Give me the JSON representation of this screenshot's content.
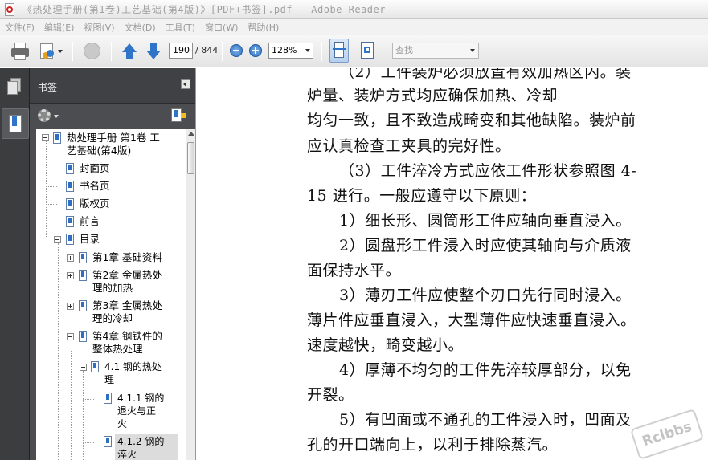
{
  "window": {
    "title": "《热处理手册(第1卷)工艺基础(第4版)》[PDF+书签].pdf - Adobe Reader"
  },
  "menu": [
    {
      "label": "文件(F)"
    },
    {
      "label": "编辑(E)"
    },
    {
      "label": "视图(V)"
    },
    {
      "label": "文档(D)"
    },
    {
      "label": "工具(T)"
    },
    {
      "label": "窗口(W)"
    },
    {
      "label": "帮助(H)"
    }
  ],
  "toolbar": {
    "page_current": "190",
    "page_total": "/ 844",
    "zoom": "128%",
    "find_placeholder": "查找"
  },
  "icons": {
    "print": "printer-icon",
    "review": "review-icon",
    "globe": "globe-icon",
    "prev": "arrow-up-icon",
    "next": "arrow-down-icon",
    "zoom_out": "zoom-out-icon",
    "zoom_in": "zoom-in-icon",
    "fit_width": "fit-width-icon",
    "fit_page": "fit-page-icon",
    "pages": "pages-icon",
    "bookmarks": "bookmarks-icon",
    "options": "gear-icon",
    "new_bookmark": "new-bookmark-icon"
  },
  "bookmarks_panel": {
    "title": "书签",
    "items": [
      {
        "label": "热处理手册 第1卷 工",
        "label2": "艺基础(第4版)",
        "level": 0,
        "toggle": "minus"
      },
      {
        "label": "封面页",
        "level": 1
      },
      {
        "label": "书名页",
        "level": 1
      },
      {
        "label": "版权页",
        "level": 1
      },
      {
        "label": "前言",
        "level": 1
      },
      {
        "label": "目录",
        "level": 1,
        "toggle": "minus"
      },
      {
        "label": "第1章 基础资料",
        "level": 2,
        "toggle": "plus"
      },
      {
        "label": "第2章 金属热处",
        "label2": "理的加热",
        "level": 2,
        "toggle": "plus"
      },
      {
        "label": "第3章 金属热处",
        "label2": "理的冷却",
        "level": 2,
        "toggle": "plus"
      },
      {
        "label": "第4章 钢铁件的",
        "label2": "整体热处理",
        "level": 2,
        "toggle": "minus"
      },
      {
        "label": "4.1 钢的热处",
        "label2": "理",
        "level": 3,
        "toggle": "minus"
      },
      {
        "label": "4.1.1 钢的",
        "label2": "退火与正",
        "label3": "火",
        "level": 4
      },
      {
        "label": "4.1.2 钢的",
        "label2": "淬火",
        "level": 4,
        "selected": true
      }
    ]
  },
  "document": {
    "lines": [
      "（2）工件装炉必须放置有效加热区内。装",
      "炉量、装炉方式均应确保加热、冷却",
      "均匀一致，且不致造成畸变和其他缺陷。装炉前",
      "应认真检查工夹具的完好性。",
      "（3）工件淬冷方式应依工件形状参照图 4-",
      "15 进行。一般应遵守以下原则：",
      "1）细长形、圆筒形工件应轴向垂直浸入。",
      "2）圆盘形工件浸入时应使其轴向与介质液",
      "面保持水平。",
      "3）薄刃工件应使整个刃口先行同时浸入。",
      "薄片件应垂直浸入，大型薄件应快速垂直浸入。",
      "速度越快，畸变越小。",
      "4）厚薄不均匀的工件先淬较厚部分，以免",
      "开裂。",
      "5）有凹面或不通孔的工件浸入时，凹面及",
      "孔的开口端向上，以利于排除蒸汽。"
    ],
    "watermark": "Rclbbs"
  },
  "colors": {
    "panel_bg": "#4b4d50",
    "rail_bg": "#3b3d3f",
    "accent_blue": "#2e74c9"
  }
}
